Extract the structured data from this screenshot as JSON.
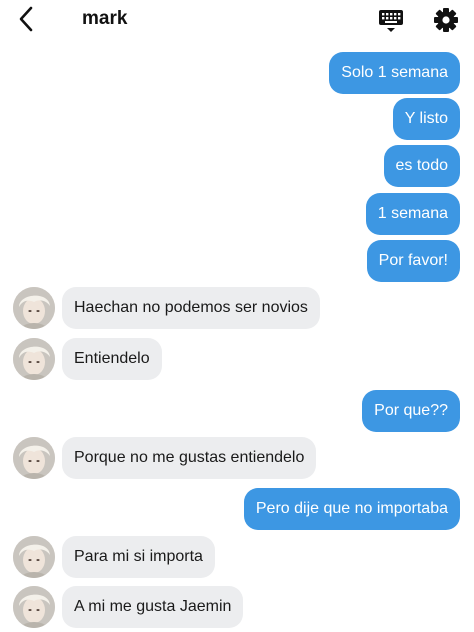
{
  "header": {
    "title": "mark",
    "back_icon": "chevron-left-icon",
    "keyboard_icon": "keyboard-icon",
    "settings_icon": "gear-icon"
  },
  "colors": {
    "outgoing_bubble": "#3d97e3",
    "incoming_bubble": "#ecedef",
    "header_text": "#111111"
  },
  "messages": [
    {
      "from": "me",
      "text": "Solo 1 semana"
    },
    {
      "from": "me",
      "text": "Y listo"
    },
    {
      "from": "me",
      "text": "es todo"
    },
    {
      "from": "me",
      "text": "1 semana"
    },
    {
      "from": "me",
      "text": "Por favor!"
    },
    {
      "from": "them",
      "text": "Haechan no podemos ser novios"
    },
    {
      "from": "them",
      "text": "Entiendelo"
    },
    {
      "from": "me",
      "text": "Por que??"
    },
    {
      "from": "them",
      "text": "Porque no me gustas entiendelo"
    },
    {
      "from": "me",
      "text": "Pero dije que no importaba"
    },
    {
      "from": "them",
      "text": "Para mi si importa"
    },
    {
      "from": "them",
      "text": "A mi me gusta Jaemin"
    }
  ]
}
